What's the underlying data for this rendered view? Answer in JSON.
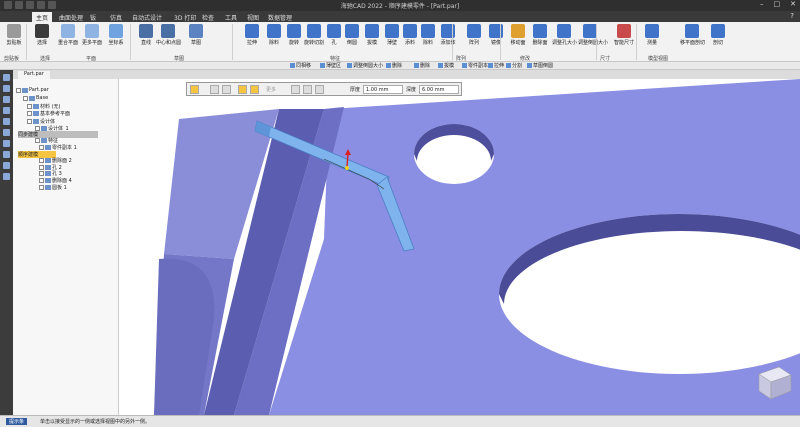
{
  "window": {
    "title": "海驰CAD 2022 - 顺序建模零件 - [Part.par]"
  },
  "menu": {
    "tabs": [
      {
        "label": "主页",
        "active": true
      },
      {
        "label": "曲面处理"
      },
      {
        "label": "钣"
      },
      {
        "label": "仿真"
      },
      {
        "label": "自动式设计"
      },
      {
        "label": "3D 打印"
      },
      {
        "label": "检查"
      },
      {
        "label": "工具"
      },
      {
        "label": "视图"
      },
      {
        "label": "数据管理"
      }
    ]
  },
  "ribbon": {
    "buttons": [
      {
        "label": "剪贴板",
        "color": "#9a9a9a"
      },
      {
        "label": "选择",
        "color": "#3a3a3a"
      },
      {
        "label": "重合平面",
        "color": "#8fb4e3"
      },
      {
        "label": "更多平面",
        "color": "#8fb4e3"
      },
      {
        "label": "坐标系",
        "color": "#6fa3e0"
      },
      {
        "label": "直线",
        "color": "#4a6fa5"
      },
      {
        "label": "中心和点圆",
        "color": "#4a6fa5"
      },
      {
        "label": "草图",
        "color": "#5b83c2"
      },
      {
        "label": "拉伸",
        "color": "#3f74c8"
      },
      {
        "label": "除料",
        "color": "#3f74c8"
      },
      {
        "label": "旋转",
        "color": "#3f74c8"
      },
      {
        "label": "旋转切割",
        "color": "#3f74c8"
      },
      {
        "label": "孔",
        "color": "#3f74c8"
      },
      {
        "label": "倒圆",
        "color": "#3f74c8"
      },
      {
        "label": "拔模",
        "color": "#3f74c8"
      },
      {
        "label": "薄壁",
        "color": "#3f74c8"
      },
      {
        "label": "添料",
        "color": "#3f74c8"
      },
      {
        "label": "除料",
        "color": "#3f74c8"
      },
      {
        "label": "添加体",
        "color": "#3f74c8"
      },
      {
        "label": "阵列",
        "color": "#3f74c8"
      },
      {
        "label": "镜像",
        "color": "#3f74c8"
      },
      {
        "label": "移动面",
        "color": "#e0a030"
      },
      {
        "label": "删除面",
        "color": "#3f74c8"
      },
      {
        "label": "调整孔大小",
        "color": "#3f74c8"
      },
      {
        "label": "调整倒圆大小",
        "color": "#3f74c8"
      },
      {
        "label": "智能尺寸",
        "color": "#c94a4a"
      },
      {
        "label": "测量",
        "color": "#3f74c8"
      },
      {
        "label": "移平面剖切",
        "color": "#3f74c8"
      },
      {
        "label": "剖切",
        "color": "#3f74c8"
      }
    ],
    "groups": [
      "剪贴板",
      "选择",
      "平面",
      "草图",
      "特征",
      "阵列",
      "修改",
      "尺寸",
      "模型视图"
    ]
  },
  "subbar": {
    "items": [
      "同相移",
      "薄壁区",
      "调整倒圆大小",
      "删除",
      "删除",
      "拔模",
      "零件副本",
      "拉伸",
      "分割",
      "草图倒圆"
    ]
  },
  "document": {
    "tab_label": "Part.par"
  },
  "pathfinder": {
    "nodes": [
      {
        "label": "Part.par",
        "type": "root"
      },
      {
        "label": "Base",
        "type": "item"
      },
      {
        "label": "材料 (无)",
        "type": "item"
      },
      {
        "label": "基本参考平面",
        "type": "item"
      },
      {
        "label": "设计体",
        "type": "item"
      },
      {
        "label": "设计体_1",
        "type": "item"
      },
      {
        "label": "同步建模",
        "type": "header"
      },
      {
        "label": "特征",
        "type": "item"
      },
      {
        "label": "零件副本 1",
        "type": "item"
      },
      {
        "label": "顺序建模",
        "type": "highlight"
      },
      {
        "label": "删除面 2",
        "type": "item"
      },
      {
        "label": "孔 2",
        "type": "item"
      },
      {
        "label": "孔 3",
        "type": "item"
      },
      {
        "label": "删除面 4",
        "type": "item"
      },
      {
        "label": "圆板 1",
        "type": "item"
      }
    ]
  },
  "commandbar": {
    "label_more": "更多",
    "thickness_label": "厚度",
    "thickness_value": "1.00 mm",
    "depth_label": "深度",
    "depth_value": "6.00 mm"
  },
  "statusbar": {
    "label": "提示条",
    "message": "单击以接受显示的一侧或选择视图中的另外一侧。"
  }
}
